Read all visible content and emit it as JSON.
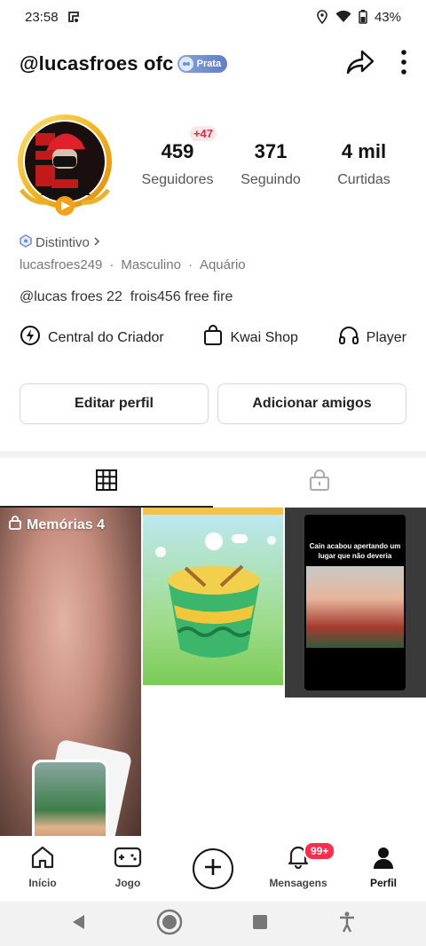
{
  "status": {
    "time": "23:58",
    "battery": "43%"
  },
  "header": {
    "username": "@lucasfroes ofc",
    "badge_label": "Prata"
  },
  "stats": [
    {
      "value": "459",
      "label": "Seguidores",
      "plus": "+47"
    },
    {
      "value": "371",
      "label": "Seguindo"
    },
    {
      "value": "4 mil",
      "label": "Curtidas"
    }
  ],
  "profile": {
    "distintivo": "Distintivo",
    "handle": "lucasfroes249",
    "gender": "Masculino",
    "sign": "Aquário",
    "separator": "·",
    "bio": "@lucas froes 22  frois456 free fire"
  },
  "quick_links": [
    {
      "label": "Central do Criador",
      "icon": "bolt-icon"
    },
    {
      "label": "Kwai Shop",
      "icon": "shopping-bag-icon"
    },
    {
      "label": "Player",
      "icon": "headphones-icon"
    }
  ],
  "actions": {
    "edit": "Editar perfil",
    "add_friends": "Adicionar amigos"
  },
  "grid": {
    "memories_label": "Memórias 4",
    "story_text": "Cain acabou apertando um lugar que não deveria"
  },
  "nav": {
    "home": "Início",
    "game": "Jogo",
    "messages": "Mensagens",
    "messages_badge": "99+",
    "profile": "Perfil"
  },
  "colors": {
    "accent_red": "#ff2d4b",
    "badge_blue": "#6f8ed0"
  }
}
